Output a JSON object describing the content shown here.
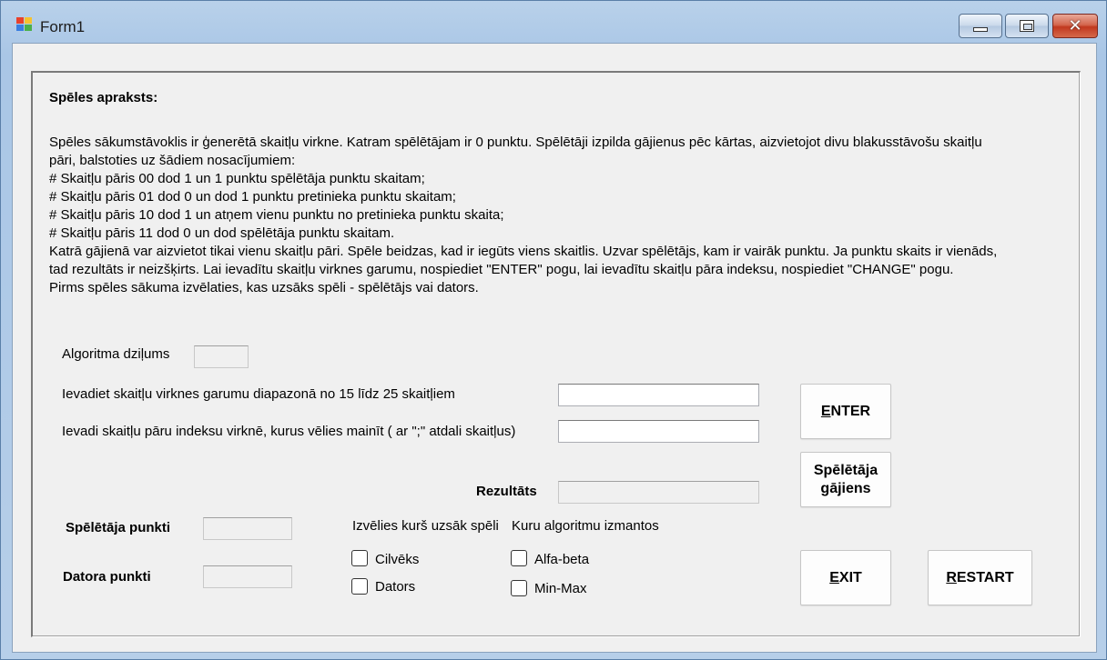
{
  "window": {
    "title": "Form1",
    "minimize_icon": "minimize-icon",
    "maximize_icon": "maximize-icon",
    "close_icon": "close-icon"
  },
  "description": {
    "heading": "Spēles apraksts:",
    "lines": [
      "Spēles sākumstāvoklis ir ģenerētā skaitļu virkne. Katram spēlētājam ir 0 punktu. Spēlētāji izpilda gājienus pēc kārtas, aizvietojot divu blakusstāvošu skaitļu",
      "pāri, balstoties uz šādiem nosacījumiem:",
      "# Skaitļu pāris 00 dod 1 un 1 punktu spēlētāja punktu skaitam;",
      "# Skaitļu pāris 01 dod 0 un dod 1 punktu pretinieka punktu skaitam;",
      "# Skaitļu pāris 10 dod 1 un atņem vienu punktu no pretinieka punktu skaita;",
      "# Skaitļu pāris 11 dod 0 un dod spēlētāja punktu skaitam.",
      "Katrā gājienā var aizvietot tikai vienu skaitļu pāri. Spēle beidzas, kad ir iegūts viens skaitlis. Uzvar spēlētājs, kam ir vairāk punktu. Ja punktu skaits ir vienāds,",
      "tad rezultāts ir neizšķirts. Lai ievadītu skaitļu virknes garumu, nospiediet \"ENTER\" pogu, lai ievadītu skaitļu pāra indeksu, nospiediet \"CHANGE\" pogu.",
      "Pirms spēles sākuma izvēlaties, kas uzsāks spēli - spēlētājs vai dators."
    ]
  },
  "form": {
    "depth_label": "Algoritma dziļums",
    "depth_value": "",
    "length_label": "Ievadiet skaitļu virknes garumu diapazonā no 15 līdz 25 skaitļiem",
    "length_value": "",
    "index_label": "Ievadi skaitļu pāru indeksu virknē, kurus vēlies mainīt ( ar \";\" atdali skaitļus)",
    "index_value": "",
    "result_label": "Rezultāts",
    "result_value": "",
    "player_points_label": "Spēlētāja punkti",
    "player_points_value": "",
    "computer_points_label": "Datora punkti",
    "computer_points_value": ""
  },
  "starter": {
    "label": "Izvēlies kurš uzsāk spēli",
    "options": [
      {
        "label": "Cilvēks",
        "checked": false
      },
      {
        "label": "Dators",
        "checked": false
      }
    ]
  },
  "algorithm": {
    "label": "Kuru algoritmu izmantos",
    "options": [
      {
        "label": "Alfa-beta",
        "checked": false
      },
      {
        "label": "Min-Max",
        "checked": false
      }
    ]
  },
  "buttons": {
    "enter": {
      "mnemonic": "E",
      "rest": "NTER"
    },
    "player_move": {
      "line1": "Spēlētāja",
      "line2": "gājiens"
    },
    "exit": {
      "mnemonic": "E",
      "rest": "XIT"
    },
    "restart": {
      "mnemonic": "R",
      "rest": "ESTART"
    }
  }
}
